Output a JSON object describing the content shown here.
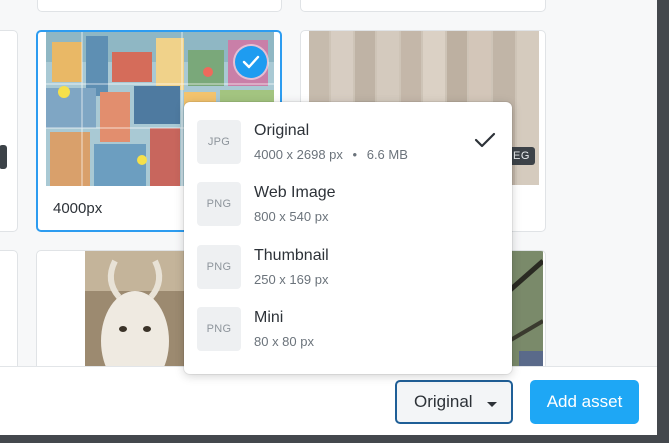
{
  "grid": {
    "selected_card": {
      "label": "4000px",
      "selected": true
    },
    "wood_card": {
      "ext_tag": "EG"
    }
  },
  "format_menu": {
    "options": [
      {
        "format": "JPG",
        "name": "Original",
        "dimensions": "4000 x 2698 px",
        "separator": "•",
        "size": "6.6 MB",
        "selected": true
      },
      {
        "format": "PNG",
        "name": "Web Image",
        "dimensions": "800 x 540 px",
        "selected": false
      },
      {
        "format": "PNG",
        "name": "Thumbnail",
        "dimensions": "250 x 169 px",
        "selected": false
      },
      {
        "format": "PNG",
        "name": "Mini",
        "dimensions": "80 x 80 px",
        "selected": false
      }
    ]
  },
  "footer": {
    "size_select_value": "Original",
    "add_button": "Add asset"
  },
  "colors": {
    "accent": "#1ea7f5",
    "selected_border": "#2d9cf0",
    "select_border": "#1f5f97"
  },
  "icons": [
    "checkmark-icon",
    "chevron-down-icon"
  ]
}
